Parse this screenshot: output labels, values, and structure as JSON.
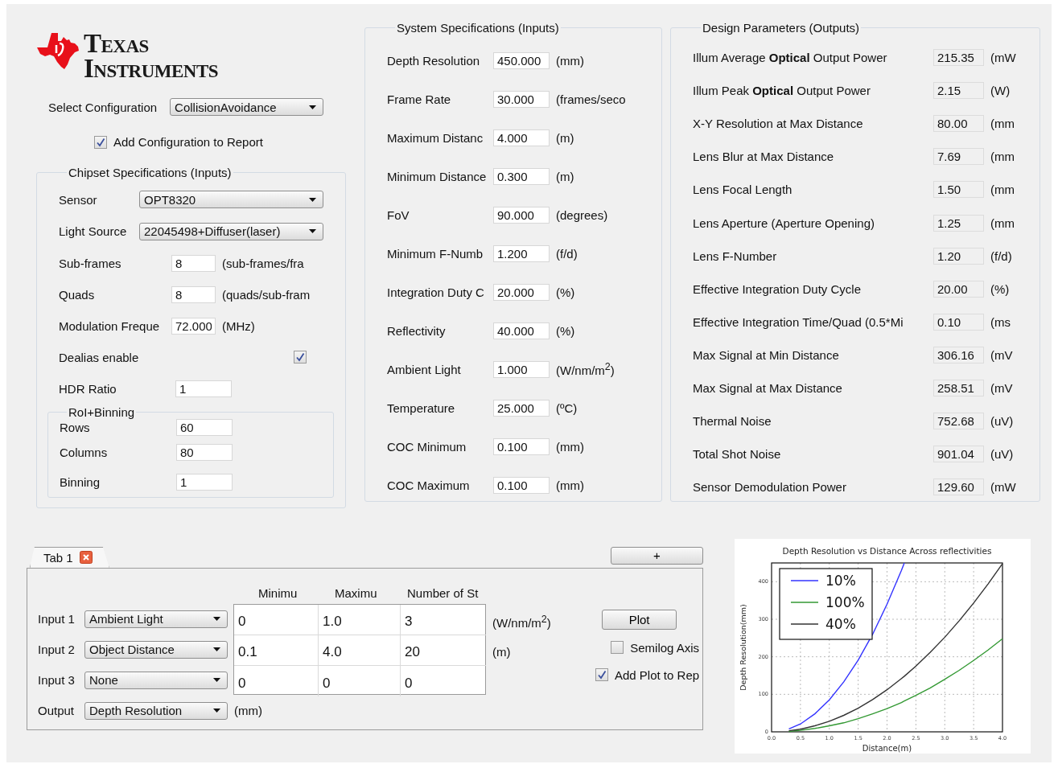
{
  "logo": {
    "line_1": "Texas",
    "line_2": "Instruments"
  },
  "configuration": {
    "label": "Select Configuration",
    "value": "CollisionAvoidance",
    "add_to_report": {
      "label": "Add Configuration to Report",
      "checked": true
    }
  },
  "chipset": {
    "title": "Chipset Specifications (Inputs)",
    "rows": [
      {
        "kind": "dropdown",
        "label": "Sensor",
        "value": "OPT8320"
      },
      {
        "kind": "dropdown",
        "label": "Light Source",
        "value": "22045498+Diffuser(laser)"
      },
      {
        "kind": "field",
        "label": "Sub-frames",
        "value": "8",
        "unit": "(sub-frames/fra"
      },
      {
        "kind": "field",
        "label": "Quads",
        "value": "8",
        "unit": "(quads/sub-fram"
      },
      {
        "kind": "field",
        "label": "Modulation Freque",
        "value": "72.000",
        "unit": "(MHz)"
      },
      {
        "kind": "checkbox",
        "label": "Dealias enable",
        "checked": true
      },
      {
        "kind": "wide_field",
        "label": "HDR Ratio",
        "value": "1"
      }
    ],
    "roi": {
      "title": "RoI+Binning",
      "rows": [
        {
          "label": "Rows",
          "value": "60"
        },
        {
          "label": "Columns",
          "value": "80"
        },
        {
          "label": "Binning",
          "value": "1"
        }
      ]
    }
  },
  "system": {
    "title": "System Specifications (Inputs)",
    "rows": [
      {
        "label": "Depth Resolution",
        "value": "450.000",
        "unit": "(mm)"
      },
      {
        "label": "Frame Rate",
        "value": "30.000",
        "unit": "(frames/seco"
      },
      {
        "label": "Maximum Distanc",
        "value": "4.000",
        "unit": "(m)"
      },
      {
        "label": "Minimum Distance",
        "value": "0.300",
        "unit": "(m)"
      },
      {
        "label": "FoV",
        "value": "90.000",
        "unit": "(degrees)"
      },
      {
        "label": "Minimum F-Numb",
        "value": "1.200",
        "unit": "(f/d)"
      },
      {
        "label": "Integration Duty C",
        "value": "20.000",
        "unit": "(%)"
      },
      {
        "label": "Reflectivity",
        "value": "40.000",
        "unit": "(%)"
      },
      {
        "label": "Ambient Light",
        "value": "1.000",
        "unit": "(W/nm/m$^{2}$)"
      },
      {
        "label": "Temperature",
        "value": "25.000",
        "unit": "(ºC)"
      },
      {
        "label": "COC Minimum",
        "value": "0.100",
        "unit": "(mm)"
      },
      {
        "label": "COC Maximum",
        "value": "0.100",
        "unit": "(mm)"
      }
    ]
  },
  "design": {
    "title": "Design Parameters (Outputs)",
    "rows": [
      {
        "label": "Illum Average **Optical** Output Power",
        "value": "215.35",
        "unit": "(mW"
      },
      {
        "label": "Illum Peak **Optical** Output Power",
        "value": "2.15",
        "unit": "(W)"
      },
      {
        "label": "X-Y Resolution at Max Distance",
        "value": "80.00",
        "unit": "(mm"
      },
      {
        "label": "Lens Blur at Max Distance",
        "value": "7.69",
        "unit": "(mm"
      },
      {
        "label": "Lens Focal Length",
        "value": "1.50",
        "unit": "(mm"
      },
      {
        "label": "Lens Aperture (Aperture Opening)",
        "value": "1.25",
        "unit": "(mm"
      },
      {
        "label": "Lens F-Number",
        "value": "1.20",
        "unit": "(f/d)"
      },
      {
        "label": "Effective Integration Duty Cycle",
        "value": "20.00",
        "unit": "(%)"
      },
      {
        "label": "Effective Integration Time/Quad (0.5*Mi",
        "value": "0.10",
        "unit": "(ms"
      },
      {
        "label": "Max Signal at Min Distance",
        "value": "306.16",
        "unit": "(mV"
      },
      {
        "label": "Max Signal at Max Distance",
        "value": "258.51",
        "unit": "(mV"
      },
      {
        "label": "Thermal Noise",
        "value": "752.68",
        "unit": "(uV)"
      },
      {
        "label": "Total Shot Noise",
        "value": "901.04",
        "unit": "(uV)"
      },
      {
        "label": "Sensor Demodulation Power",
        "value": "129.60",
        "unit": "(mW"
      }
    ]
  },
  "sweep": {
    "tabs": [
      {
        "label": "Tab 1",
        "selected": true
      }
    ],
    "add_tab_button": "+",
    "columns": [
      "Minimu",
      "Maximu",
      "Number of St"
    ],
    "inputs": [
      {
        "label": "Input 1",
        "value": "Ambient Light",
        "cells": [
          "0",
          "1.0",
          "3"
        ],
        "unit": "(W/nm/m$^{2}$)"
      },
      {
        "label": "Input 2",
        "value": "Object Distance",
        "cells": [
          "0.1",
          "4.0",
          "20"
        ],
        "unit": "(m)"
      },
      {
        "label": "Input 3",
        "value": "None",
        "cells": [
          "0",
          "0",
          "0"
        ]
      }
    ],
    "output": {
      "label": "Output",
      "value": "Depth Resolution",
      "unit": "(mm)"
    },
    "plot_button": "Plot",
    "options": [
      {
        "label": "Semilog Axis",
        "checked": false
      },
      {
        "label": "Add Plot to Rep",
        "checked": true
      }
    ]
  },
  "plot": {
    "chart_data": {
      "type": "line",
      "title": "Depth Resolution vs Distance Across reflectivities",
      "xlabel": "Distance(m)",
      "ylabel": "Depth Resolution(mm)",
      "x": [
        0.3,
        0.5,
        0.75,
        1.0,
        1.25,
        1.5,
        1.75,
        2.0,
        2.25,
        2.3,
        2.5,
        2.75,
        3.0,
        3.25,
        3.5,
        3.75,
        4.0
      ],
      "series": [
        {
          "name": "10%",
          "color": "#3333ff",
          "values": [
            8,
            21,
            48,
            85,
            133,
            191,
            260,
            340,
            430,
            450,
            null,
            null,
            null,
            null,
            null,
            null,
            null
          ]
        },
        {
          "name": "100%",
          "color": "#339933",
          "values": [
            1,
            4,
            9,
            16,
            24,
            35,
            48,
            62,
            78,
            82,
            97,
            117,
            140,
            164,
            190,
            218,
            248
          ]
        },
        {
          "name": "40%",
          "color": "#333333",
          "values": [
            3,
            7,
            16,
            28,
            44,
            63,
            86,
            112,
            142,
            148,
            175,
            212,
            252,
            296,
            343,
            394,
            448
          ]
        }
      ],
      "xlim": [
        0,
        4
      ],
      "ylim": [
        0,
        450
      ],
      "xticks": [
        {
          "value": 0,
          "label": "0.0"
        },
        {
          "value": 0.5,
          "label": "0.5"
        },
        {
          "value": 1,
          "label": "1.0"
        },
        {
          "value": 1.5,
          "label": "1.5"
        },
        {
          "value": 2,
          "label": "2.0"
        },
        {
          "value": 2.5,
          "label": "2.5"
        },
        {
          "value": 3,
          "label": "3.0"
        },
        {
          "value": 3.5,
          "label": "3.5"
        },
        {
          "value": 4,
          "label": "4.0"
        }
      ],
      "yticks": [
        0,
        100,
        200,
        300,
        400
      ],
      "grid": true,
      "legend": true
    }
  }
}
